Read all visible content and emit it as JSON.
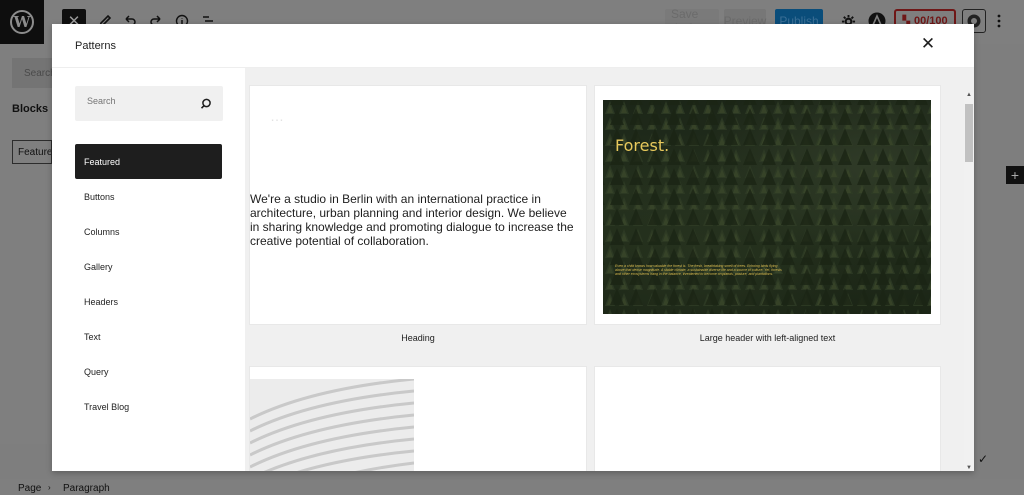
{
  "editor": {
    "close_label": "✕",
    "save_draft": "Save draft",
    "preview": "Preview",
    "publish": "Publish",
    "score": "00/100",
    "bg_search": "Search",
    "bg_blocks": "Blocks",
    "bg_featured": "Featured",
    "plus": "+",
    "breadcrumb": [
      "Page",
      "Paragraph"
    ]
  },
  "modal": {
    "title": "Patterns",
    "close": "✕",
    "search": {
      "placeholder": "Search"
    },
    "categories": [
      "Featured",
      "Buttons",
      "Columns",
      "Gallery",
      "Headers",
      "Text",
      "Query",
      "Travel Blog"
    ],
    "active_category": "Featured"
  },
  "patterns": [
    {
      "caption": "Heading",
      "ghost_text": "…",
      "body": "We're a studio in Berlin with an international practice in architecture, urban planning and interior design. We believe in sharing knowledge and promoting dialogue to increase the creative potential of collaboration."
    },
    {
      "caption": "Large header with left-aligned text",
      "title": "Forest.",
      "body": "Even a child knows how valuable the forest is. The fresh, breathtaking smell of trees. Echoing birds flying above that dense magnitude. A stable climate, a sustainable diverse life and a source of culture. Yet, forests and other ecosystems hang in the balance, threatened to become croplands, pasture, and plantations."
    }
  ],
  "colors": {
    "accent": "#1e1e1e",
    "forest_text": "#e8c95c",
    "overlay": "#7f7f7f"
  }
}
